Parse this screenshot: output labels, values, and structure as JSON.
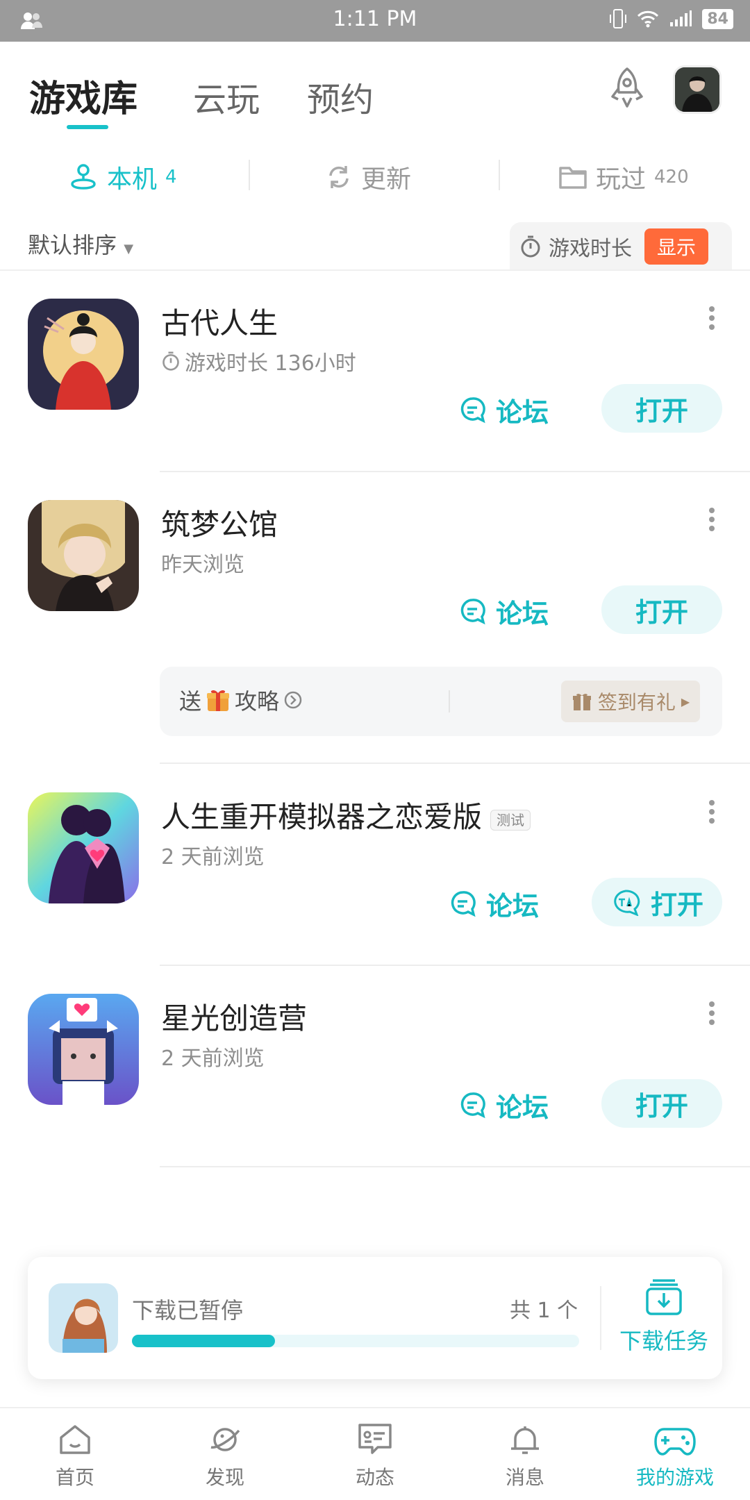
{
  "status_bar": {
    "time": "1:11 PM",
    "battery": "84"
  },
  "top_tabs": [
    {
      "label": "游戏库"
    },
    {
      "label": "云玩"
    },
    {
      "label": "预约"
    }
  ],
  "sub_tabs": [
    {
      "label": "本机",
      "count": "4"
    },
    {
      "label": "更新",
      "count": ""
    },
    {
      "label": "玩过",
      "count": "420"
    }
  ],
  "sort": {
    "label": "默认排序"
  },
  "playtime_toggle": {
    "label": "游戏时长",
    "button": "显示"
  },
  "games": [
    {
      "name": "古代人生",
      "sub": "游戏时长 136小时",
      "forum": "论坛",
      "open": "打开"
    },
    {
      "name": "筑梦公馆",
      "sub": "昨天浏览",
      "forum": "论坛",
      "open": "打开"
    },
    {
      "name": "人生重开模拟器之恋爱版",
      "badge": "测试",
      "sub": "2 天前浏览",
      "forum": "论坛",
      "open": "打开"
    },
    {
      "name": "星光创造营",
      "sub": "2 天前浏览",
      "forum": "论坛",
      "open": "打开"
    }
  ],
  "promo": {
    "left_a": "送",
    "left_b": "攻略",
    "right": "签到有礼"
  },
  "download": {
    "status": "下载已暂停",
    "total": "共 1 个",
    "tasks": "下载任务",
    "progress": 0.32
  },
  "bottom_nav": [
    {
      "label": "首页"
    },
    {
      "label": "发现"
    },
    {
      "label": "动态"
    },
    {
      "label": "消息"
    },
    {
      "label": "我的游戏"
    }
  ],
  "colors": {
    "accent": "#18c1c9",
    "orange": "#ff6a3a"
  }
}
